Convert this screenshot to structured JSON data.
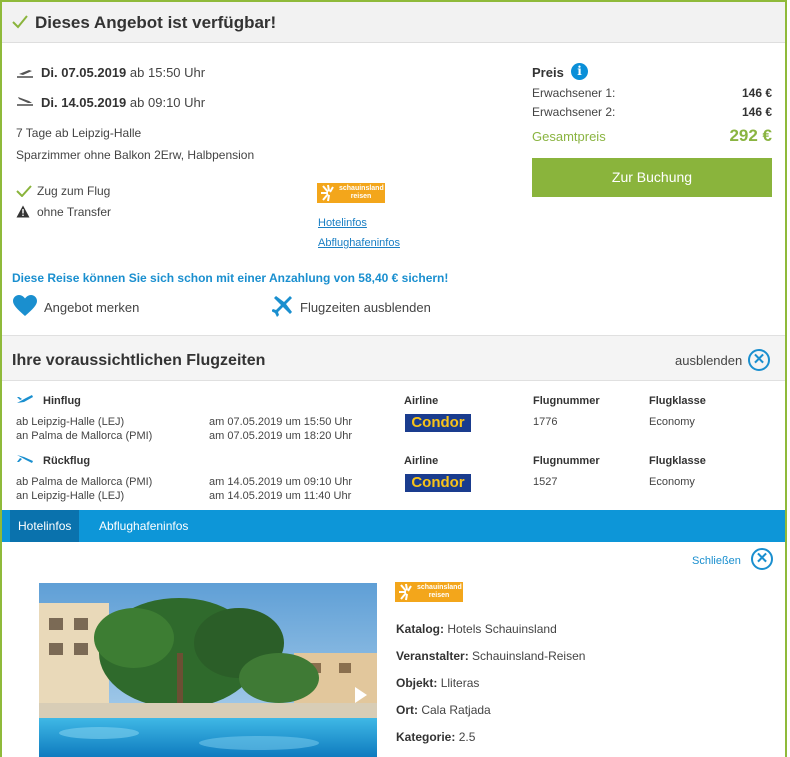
{
  "availability": {
    "title": "Dieses Angebot ist verfügbar!"
  },
  "outbound": {
    "date": "Di. 07.05.2019",
    "time_text": "ab 15:50 Uhr"
  },
  "inbound": {
    "date": "Di. 14.05.2019",
    "time_text": "ab 09:10 Uhr"
  },
  "trip": {
    "duration": "7 Tage ab Leipzig-Halle",
    "room": "Sparzimmer ohne Balkon 2Erw, Halbpension",
    "feature_train": "Zug zum Flug",
    "feature_transfer": "ohne Transfer"
  },
  "operator_logo": {
    "line1": "schauinsland",
    "line2": "reisen"
  },
  "links": {
    "hotelinfos": "Hotelinfos",
    "abflughafeninfos": "Abflughafeninfos"
  },
  "price": {
    "label": "Preis",
    "info_icon": "i",
    "adult1_label": "Erwachsener 1:",
    "adult1_value": "146 €",
    "adult2_label": "Erwachsener 2:",
    "adult2_value": "146 €",
    "total_label": "Gesamtpreis",
    "total_value": "292 €",
    "book_button": "Zur Buchung"
  },
  "deposit_text": "Diese Reise können Sie sich schon mit einer Anzahlung von 58,40 € sichern!",
  "actions": {
    "remember": "Angebot merken",
    "hide_flights": "Flugzeiten ausblenden"
  },
  "flights": {
    "title": "Ihre voraussichtlichen Flugzeiten",
    "hide_label": "ausblenden",
    "close_glyph": "✕",
    "col_airline": "Airline",
    "col_number": "Flugnummer",
    "col_class": "Flugklasse",
    "legs": [
      {
        "label": "Hinflug",
        "dep_airport": "ab Leipzig-Halle (LEJ)",
        "dep_time": "am 07.05.2019 um 15:50 Uhr",
        "arr_airport": "an Palma de Mallorca (PMI)",
        "arr_time": "am 07.05.2019 um 18:20 Uhr",
        "airline": "Condor",
        "number": "1776",
        "class": "Economy"
      },
      {
        "label": "Rückflug",
        "dep_airport": "ab Palma de Mallorca (PMI)",
        "dep_time": "am 14.05.2019 um 09:10 Uhr",
        "arr_airport": "an Leipzig-Halle (LEJ)",
        "arr_time": "am 14.05.2019 um 11:40 Uhr",
        "airline": "Condor",
        "number": "1527",
        "class": "Economy"
      }
    ]
  },
  "tabs": {
    "hotelinfos": "Hotelinfos",
    "abflughafeninfos": "Abflughafeninfos"
  },
  "hotel_panel": {
    "close_label": "Schließen",
    "katalog_label": "Katalog:",
    "katalog_value": "Hotels Schauinsland",
    "veranstalter_label": "Veranstalter:",
    "veranstalter_value": "Schauinsland-Reisen",
    "objekt_label": "Objekt:",
    "objekt_value": "Lliteras",
    "ort_label": "Ort:",
    "ort_value": "Cala Ratjada",
    "kategorie_label": "Kategorie:",
    "kategorie_value": "2.5"
  },
  "colors": {
    "accent_green": "#8ab43c",
    "accent_blue": "#0d96d8",
    "tab_active": "#0a72ad",
    "logo_orange": "#f3a61b",
    "condor_navy": "#1a3c8e",
    "condor_yellow": "#f7c21a"
  },
  "icons": [
    "checkmark-icon",
    "takeoff-icon",
    "landing-icon",
    "warning-icon",
    "info-icon",
    "heart-icon",
    "airplane-icon",
    "close-circle-icon",
    "play-icon"
  ]
}
